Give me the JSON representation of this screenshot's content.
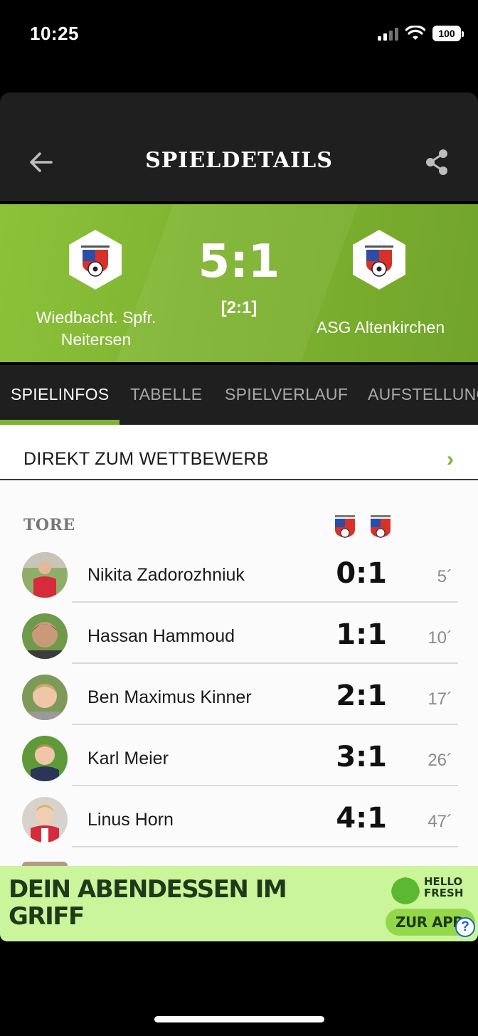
{
  "status_bar": {
    "time": "10:25",
    "battery": "100"
  },
  "header": {
    "title": "SPIELDETAILS",
    "back_icon": "arrow-left-icon",
    "share_icon": "share-icon"
  },
  "match": {
    "home_team": "Wiedbacht. Spfr. Neitersen",
    "away_team": "ASG Altenkirchen",
    "score": "5:1",
    "halftime": "[2:1]"
  },
  "tabs": [
    {
      "label": "SPIELINFOS",
      "active": true
    },
    {
      "label": "TABELLE",
      "active": false
    },
    {
      "label": "SPIELVERLAUF",
      "active": false
    },
    {
      "label": "AUFSTELLUNG",
      "active": false
    }
  ],
  "competition_link": {
    "label": "DIREKT ZUM WETTBEWERB",
    "icon": "chevron-right-icon"
  },
  "goals": {
    "title": "TORE",
    "items": [
      {
        "name": "Nikita Zadorozhniuk",
        "score": "0:1",
        "minute": "5´"
      },
      {
        "name": "Hassan Hammoud",
        "score": "1:1",
        "minute": "10´"
      },
      {
        "name": "Ben Maximus Kinner",
        "score": "2:1",
        "minute": "17´"
      },
      {
        "name": "Karl Meier",
        "score": "3:1",
        "minute": "26´"
      },
      {
        "name": "Linus Horn",
        "score": "4:1",
        "minute": "47´"
      }
    ]
  },
  "ad": {
    "headline_line1": "DEIN ABENDESSEN IM",
    "headline_line2": "GRIFF",
    "brand_line1": "HELLO",
    "brand_line2": "FRESH",
    "cta": "ZUR APP",
    "help": "?"
  },
  "colors": {
    "accent": "#7fb431",
    "header_bg": "#1f1f1f",
    "ad_bg": "#cbf59a"
  }
}
